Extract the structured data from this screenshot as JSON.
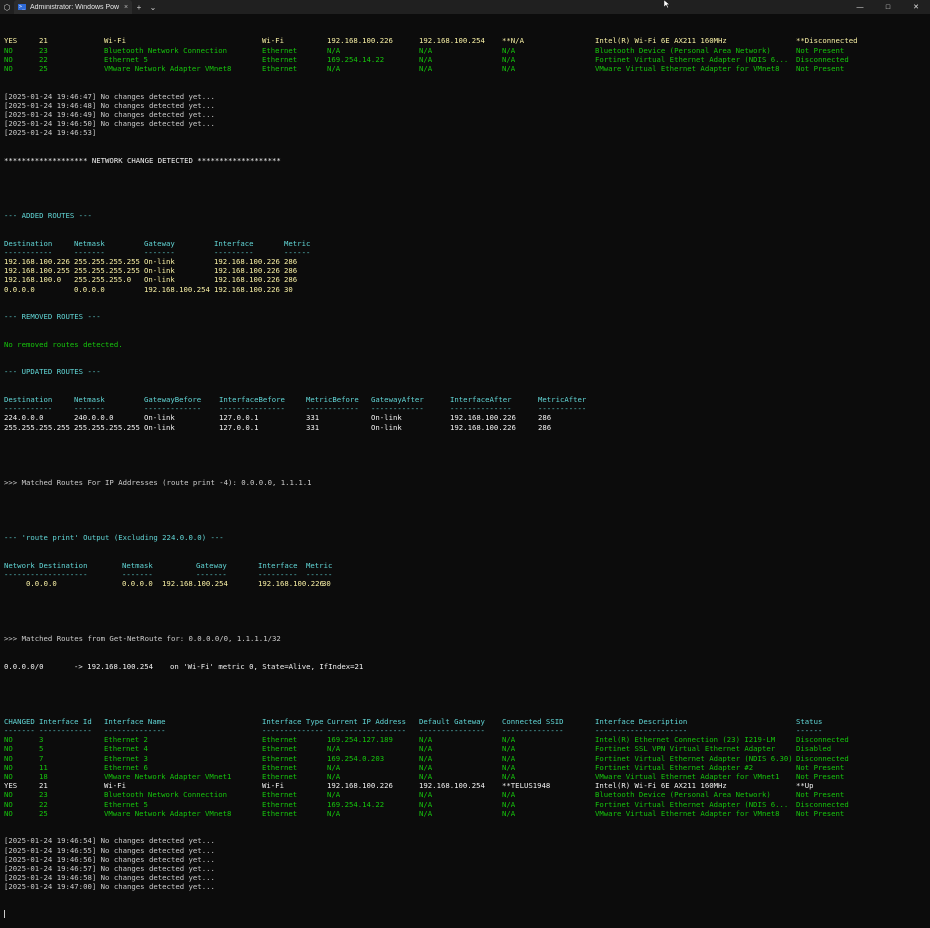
{
  "window": {
    "tab_title": "Administrator: Windows Pow",
    "tab_close": "×",
    "new_tab": "+",
    "dropdown": "⌄",
    "minimize": "—",
    "maximize": "□",
    "close": "✕"
  },
  "colors": {
    "background": "#0c0c0c",
    "green": "#16c60c",
    "yellow": "#f9f1a5",
    "cyan": "#61d6d6",
    "gray": "#cccccc",
    "white": "#f2f2f2"
  },
  "table1_rows": [
    {
      "cls": "y",
      "cells": [
        "YES",
        "21",
        "Wi-Fi",
        "Wi-Fi",
        "192.168.100.226",
        "192.168.100.254",
        "**N/A",
        "Intel(R) Wi-Fi 6E AX211 160MHz",
        "**Disconnected"
      ]
    },
    {
      "cls": "g",
      "cells": [
        "NO",
        "23",
        "Bluetooth Network Connection",
        "Ethernet",
        "N/A",
        "N/A",
        "N/A",
        "Bluetooth Device (Personal Area Network)",
        "Not Present"
      ]
    },
    {
      "cls": "g",
      "cells": [
        "NO",
        "22",
        "Ethernet 5",
        "Ethernet",
        "169.254.14.22",
        "N/A",
        "N/A",
        "Fortinet Virtual Ethernet Adapter (NDIS 6...",
        "Disconnected"
      ]
    },
    {
      "cls": "g",
      "cells": [
        "NO",
        "25",
        "VMware Network Adapter VMnet8",
        "Ethernet",
        "N/A",
        "N/A",
        "N/A",
        "VMware Virtual Ethernet Adapter for VMnet8",
        "Not Present"
      ]
    }
  ],
  "log1": [
    "[2025-01-24 19:46:47] No changes detected yet...",
    "[2025-01-24 19:46:48] No changes detected yet...",
    "[2025-01-24 19:46:49] No changes detected yet...",
    "[2025-01-24 19:46:50] No changes detected yet...",
    "[2025-01-24 19:46:53]"
  ],
  "change_banner": "******************* NETWORK CHANGE DETECTED *******************",
  "added_routes": {
    "header": "--- ADDED ROUTES ---",
    "columns": [
      "Destination",
      "Netmask",
      "Gateway",
      "Interface",
      "Metric"
    ],
    "underline": [
      "-----------",
      "-------",
      "-------",
      "---------",
      "------"
    ],
    "rows": [
      [
        "192.168.100.226",
        "255.255.255.255",
        "On-link",
        "192.168.100.226",
        "286"
      ],
      [
        "192.168.100.255",
        "255.255.255.255",
        "On-link",
        "192.168.100.226",
        "286"
      ],
      [
        "192.168.100.0",
        "255.255.255.0",
        "On-link",
        "192.168.100.226",
        "286"
      ],
      [
        "0.0.0.0",
        "0.0.0.0",
        "192.168.100.254",
        "192.168.100.226",
        "30"
      ]
    ]
  },
  "removed_routes": {
    "header": "--- REMOVED ROUTES ---",
    "message": "No removed routes detected."
  },
  "updated_routes": {
    "header": "--- UPDATED ROUTES ---",
    "columns": [
      "Destination",
      "Netmask",
      "GatewayBefore",
      "InterfaceBefore",
      "MetricBefore",
      "GatewayAfter",
      "InterfaceAfter",
      "MetricAfter"
    ],
    "underline": [
      "-----------",
      "-------",
      "-------------",
      "---------------",
      "------------",
      "------------",
      "--------------",
      "-----------"
    ],
    "rows": [
      [
        "224.0.0.0",
        "240.0.0.0",
        "On-link",
        "127.0.0.1",
        "331",
        "On-link",
        "192.168.100.226",
        "286"
      ],
      [
        "255.255.255.255",
        "255.255.255.255",
        "On-link",
        "127.0.0.1",
        "331",
        "On-link",
        "192.168.100.226",
        "286"
      ]
    ]
  },
  "matched_routes_line": ">>> Matched Routes For IP Addresses (route print -4): 0.0.0.0, 1.1.1.1",
  "route_print": {
    "header": "--- 'route print' Output (Excluding 224.0.0.0) ---",
    "columns": [
      "Network Destination",
      "Netmask",
      "Gateway",
      "Interface",
      "Metric"
    ],
    "underline": [
      "-------------------",
      "-------",
      "-------",
      "---------",
      "------"
    ],
    "rows": [
      [
        "0.0.0.0",
        "0.0.0.0",
        "192.168.100.254",
        "192.168.100.226",
        "30"
      ]
    ]
  },
  "getnetroute": {
    "header": ">>> Matched Routes from Get-NetRoute for: 0.0.0.0/0, 1.1.1.1/32",
    "row_dest": "0.0.0.0/0",
    "row_arrow": "-> 192.168.100.254",
    "row_info": "on 'Wi-Fi' metric 0, State=Alive, IfIndex=21"
  },
  "table2": {
    "columns": [
      "CHANGED",
      "Interface Id",
      "Interface Name",
      "Interface Type",
      "Current IP Address",
      "Default Gateway",
      "Connected SSID",
      "Interface Description",
      "Status"
    ],
    "underline": [
      "-------",
      "------------",
      "--------------",
      "--------------",
      "------------------",
      "---------------",
      "--------------",
      "---------------------",
      "------"
    ],
    "rows": [
      {
        "cls": "g",
        "cells": [
          "NO",
          "3",
          "Ethernet 2",
          "Ethernet",
          "169.254.127.189",
          "N/A",
          "N/A",
          "Intel(R) Ethernet Connection (23) I219-LM",
          "Disconnected"
        ]
      },
      {
        "cls": "g",
        "cells": [
          "NO",
          "5",
          "Ethernet 4",
          "Ethernet",
          "N/A",
          "N/A",
          "N/A",
          "Fortinet SSL VPN Virtual Ethernet Adapter",
          "Disabled"
        ]
      },
      {
        "cls": "g",
        "cells": [
          "NO",
          "7",
          "Ethernet 3",
          "Ethernet",
          "169.254.0.203",
          "N/A",
          "N/A",
          "Fortinet Virtual Ethernet Adapter (NDIS 6.30)",
          "Disconnected"
        ]
      },
      {
        "cls": "g",
        "cells": [
          "NO",
          "11",
          "Ethernet 6",
          "Ethernet",
          "N/A",
          "N/A",
          "N/A",
          "Fortinet Virtual Ethernet Adapter #2",
          "Not Present"
        ]
      },
      {
        "cls": "g",
        "cells": [
          "NO",
          "18",
          "VMware Network Adapter VMnet1",
          "Ethernet",
          "N/A",
          "N/A",
          "N/A",
          "VMware Virtual Ethernet Adapter for VMnet1",
          "Not Present"
        ]
      },
      {
        "cls": "w",
        "cells": [
          "YES",
          "21",
          "Wi-Fi",
          "Wi-Fi",
          "192.168.100.226",
          "192.168.100.254",
          "**TELUS1948",
          "Intel(R) Wi-Fi 6E AX211 160MHz",
          "**Up"
        ]
      },
      {
        "cls": "g",
        "cells": [
          "NO",
          "23",
          "Bluetooth Network Connection",
          "Ethernet",
          "N/A",
          "N/A",
          "N/A",
          "Bluetooth Device (Personal Area Network)",
          "Not Present"
        ]
      },
      {
        "cls": "g",
        "cells": [
          "NO",
          "22",
          "Ethernet 5",
          "Ethernet",
          "169.254.14.22",
          "N/A",
          "N/A",
          "Fortinet Virtual Ethernet Adapter (NDIS 6...",
          "Disconnected"
        ]
      },
      {
        "cls": "g",
        "cells": [
          "NO",
          "25",
          "VMware Network Adapter VMnet8",
          "Ethernet",
          "N/A",
          "N/A",
          "N/A",
          "VMware Virtual Ethernet Adapter for VMnet8",
          "Not Present"
        ]
      }
    ]
  },
  "log2": [
    "[2025-01-24 19:46:54] No changes detected yet...",
    "[2025-01-24 19:46:55] No changes detected yet...",
    "[2025-01-24 19:46:56] No changes detected yet...",
    "[2025-01-24 19:46:57] No changes detected yet...",
    "[2025-01-24 19:46:58] No changes detected yet...",
    "[2025-01-24 19:47:00] No changes detected yet..."
  ]
}
